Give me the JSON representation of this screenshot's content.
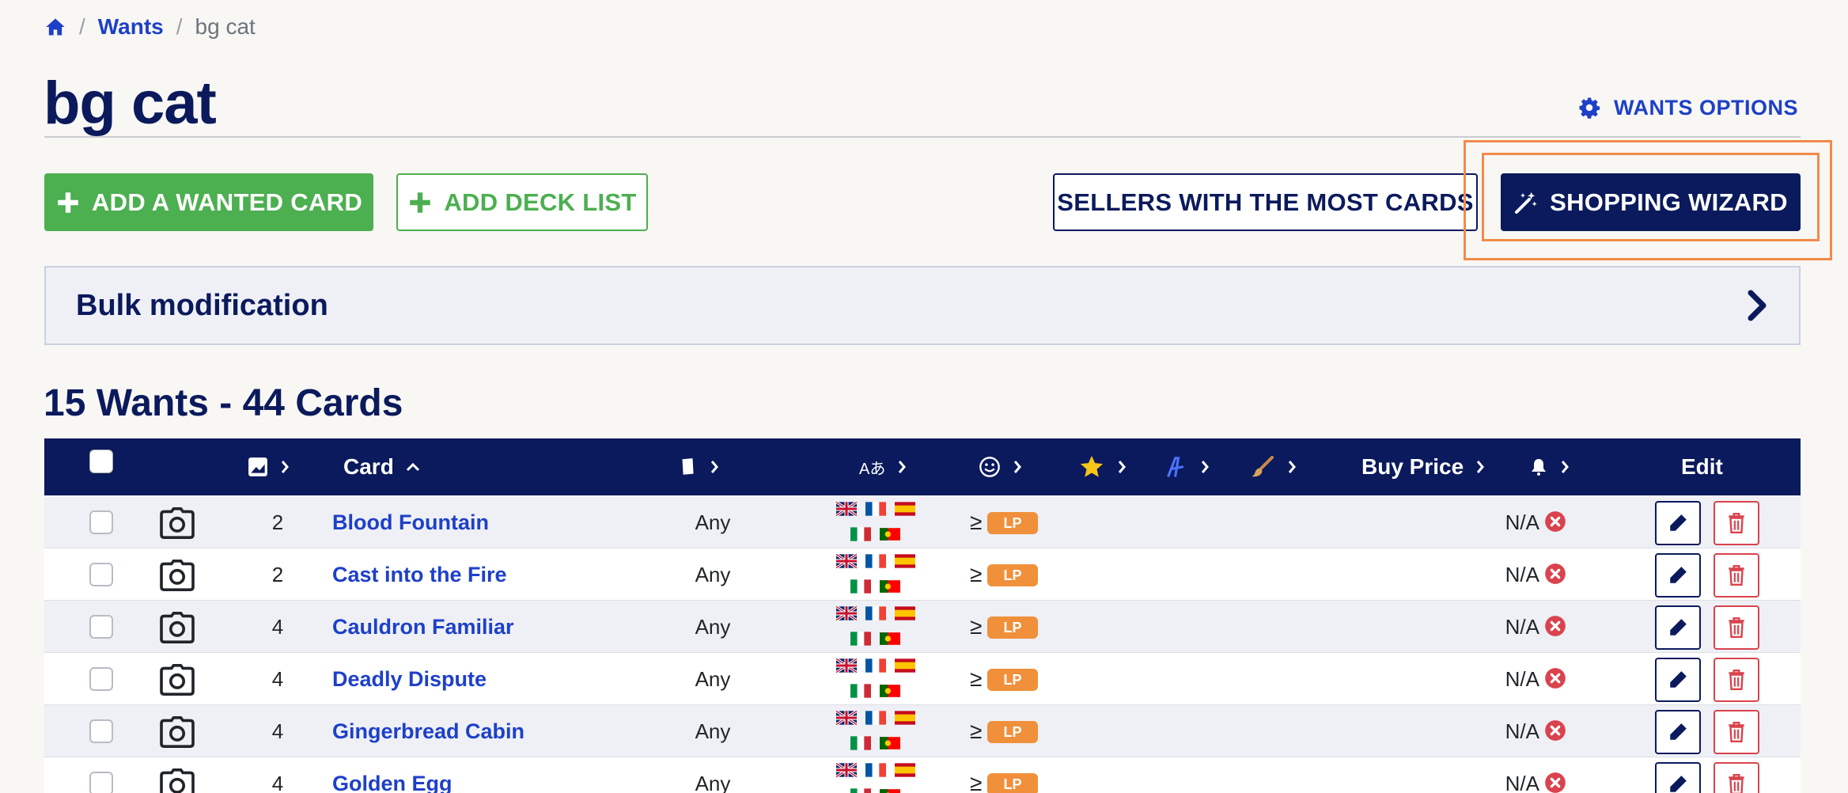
{
  "breadcrumb": {
    "home_icon": "home-icon",
    "separator": "/",
    "wants": "Wants",
    "current": "bg cat"
  },
  "page": {
    "title": "bg cat",
    "wants_options": "WANTS OPTIONS"
  },
  "actions": {
    "add_card": "ADD A WANTED CARD",
    "add_deck": "ADD DECK LIST",
    "sellers": "SELLERS WITH THE MOST CARDS",
    "wizard": "SHOPPING WIZARD"
  },
  "bulk": {
    "title": "Bulk modification"
  },
  "summary": {
    "heading": "15 Wants - 44 Cards"
  },
  "table": {
    "headers": {
      "card": "Card",
      "buy_price": "Buy Price",
      "edit": "Edit",
      "lang_icon_text": "Aあ"
    },
    "rows": [
      {
        "qty": "2",
        "name": "Blood Fountain",
        "condition": "Any",
        "min_cond_prefix": "≥",
        "min_cond": "LP",
        "price": "N/A"
      },
      {
        "qty": "2",
        "name": "Cast into the Fire",
        "condition": "Any",
        "min_cond_prefix": "≥",
        "min_cond": "LP",
        "price": "N/A"
      },
      {
        "qty": "4",
        "name": "Cauldron Familiar",
        "condition": "Any",
        "min_cond_prefix": "≥",
        "min_cond": "LP",
        "price": "N/A"
      },
      {
        "qty": "4",
        "name": "Deadly Dispute",
        "condition": "Any",
        "min_cond_prefix": "≥",
        "min_cond": "LP",
        "price": "N/A"
      },
      {
        "qty": "4",
        "name": "Gingerbread Cabin",
        "condition": "Any",
        "min_cond_prefix": "≥",
        "min_cond": "LP",
        "price": "N/A"
      },
      {
        "qty": "4",
        "name": "Golden Egg",
        "condition": "Any",
        "min_cond_prefix": "≥",
        "min_cond": "LP",
        "price": "N/A"
      }
    ]
  },
  "colors": {
    "navy": "#0b1a5c",
    "link": "#1e40c8",
    "green": "#4caf50",
    "lp": "#f0903a",
    "danger": "#d9434d",
    "highlight": "#f28a4b"
  }
}
